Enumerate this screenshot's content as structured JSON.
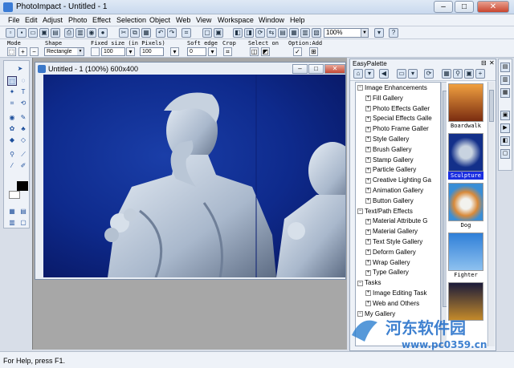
{
  "window": {
    "title": "PhotoImpact - Untitled - 1",
    "btn_min": "–",
    "btn_max": "□",
    "btn_close": "✕"
  },
  "menu": {
    "items": [
      "File",
      "Edit",
      "Adjust",
      "Photo",
      "Effect",
      "Selection",
      "Object",
      "Web",
      "View",
      "Workspace",
      "Window",
      "Help"
    ]
  },
  "toolbar": {
    "zoom": "100%"
  },
  "attributes": {
    "mode_label": "Mode",
    "shape_label": "Shape",
    "shape_value": "Rectangle",
    "fixed_label": "Fixed size (in Pixels)",
    "width": "100",
    "height": "100",
    "soft_label": "Soft edge",
    "soft_value": "0",
    "crop_label": "Crop",
    "select_label": "Select on",
    "option_label": "Option:Add"
  },
  "document": {
    "title": "Untitled - 1 (100%) 600x400"
  },
  "status": {
    "text": "For Help, press F1."
  },
  "palette": {
    "title": "EasyPalette",
    "tree": [
      {
        "label": "Image Enhancements",
        "level": 0,
        "toggle": "−"
      },
      {
        "label": "Fill Gallery",
        "level": 1,
        "toggle": "+"
      },
      {
        "label": "Photo Effects Galler",
        "level": 1,
        "toggle": "+"
      },
      {
        "label": "Special Effects Galle",
        "level": 1,
        "toggle": "+"
      },
      {
        "label": "Photo Frame Galler",
        "level": 1,
        "toggle": "+"
      },
      {
        "label": "Style Gallery",
        "level": 1,
        "toggle": "+"
      },
      {
        "label": "Brush Gallery",
        "level": 1,
        "toggle": "+"
      },
      {
        "label": "Stamp Gallery",
        "level": 1,
        "toggle": "+"
      },
      {
        "label": "Particle Gallery",
        "level": 1,
        "toggle": "+"
      },
      {
        "label": "Creative Lighting Ga",
        "level": 1,
        "toggle": "+"
      },
      {
        "label": "Animation Gallery",
        "level": 1,
        "toggle": "+"
      },
      {
        "label": "Button Gallery",
        "level": 1,
        "toggle": "+"
      },
      {
        "label": "Text/Path Effects",
        "level": 0,
        "toggle": "−"
      },
      {
        "label": "Material Attribute G",
        "level": 1,
        "toggle": "+"
      },
      {
        "label": "Material Gallery",
        "level": 1,
        "toggle": "+"
      },
      {
        "label": "Text Style Gallery",
        "level": 1,
        "toggle": "+"
      },
      {
        "label": "Deform Gallery",
        "level": 1,
        "toggle": "+"
      },
      {
        "label": "Wrap Gallery",
        "level": 1,
        "toggle": "+"
      },
      {
        "label": "Type Gallery",
        "level": 1,
        "toggle": "+"
      },
      {
        "label": "Tasks",
        "level": 0,
        "toggle": "−"
      },
      {
        "label": "Image Editing Task",
        "level": 1,
        "toggle": "+"
      },
      {
        "label": "Web and Others",
        "level": 1,
        "toggle": "+"
      },
      {
        "label": "My Gallery",
        "level": 0,
        "toggle": "−"
      }
    ],
    "thumbnails": [
      {
        "caption": "Boardwalk",
        "selected": false
      },
      {
        "caption": "Sculpture",
        "selected": true
      },
      {
        "caption": "Dog",
        "selected": false
      },
      {
        "caption": "Fighter ...",
        "selected": false
      },
      {
        "caption": "",
        "selected": false
      }
    ]
  },
  "watermark": {
    "text": "河东软件园",
    "url": "www.pc0359.cn"
  }
}
